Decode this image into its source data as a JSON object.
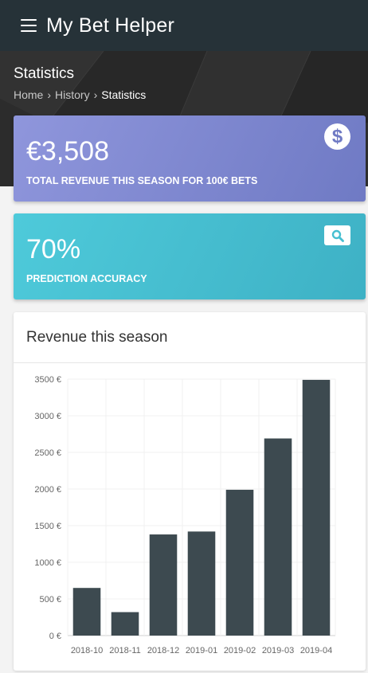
{
  "app": {
    "title": "My Bet Helper"
  },
  "header": {
    "page_title": "Statistics",
    "breadcrumb": [
      "Home",
      "History",
      "Statistics"
    ],
    "separator": "›"
  },
  "cards": {
    "revenue": {
      "value": "€3,508",
      "label": "TOTAL REVENUE THIS SEASON FOR 100€ BETS",
      "icon": "dollar-circle-icon",
      "color": "#7b84cf"
    },
    "accuracy": {
      "value": "70%",
      "label": "PREDICTION ACCURACY",
      "icon": "search-icon",
      "color": "#46bfd1"
    }
  },
  "chart_card": {
    "title": "Revenue this season"
  },
  "chart_data": {
    "type": "bar",
    "categories": [
      "2018-10",
      "2018-11",
      "2018-12",
      "2019-01",
      "2019-02",
      "2019-03",
      "2019-04"
    ],
    "values": [
      650,
      320,
      1380,
      1420,
      1990,
      2690,
      3490
    ],
    "ylim": [
      0,
      3500
    ],
    "yticks": [
      0,
      500,
      1000,
      1500,
      2000,
      2500,
      3000,
      3500
    ],
    "y_unit": "€",
    "grid": true,
    "bar_color": "#3d4a50"
  }
}
